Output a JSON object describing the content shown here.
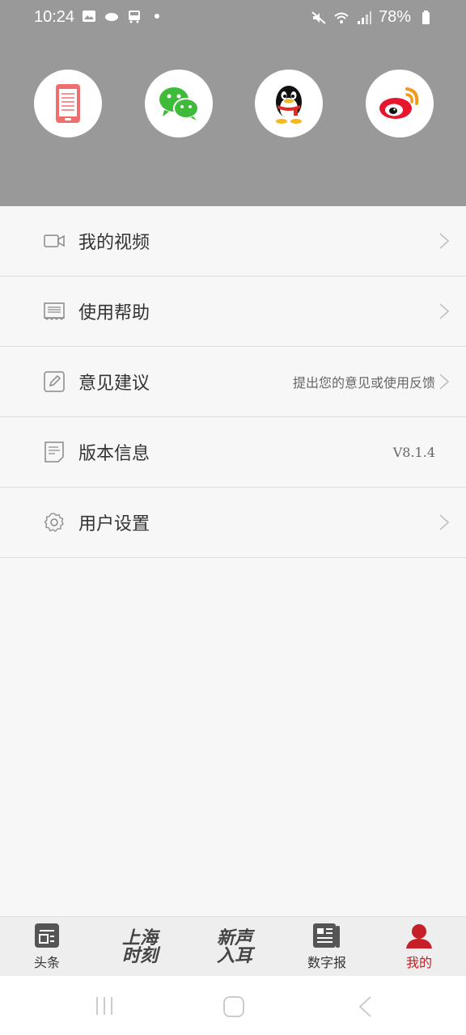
{
  "status_bar": {
    "time": "10:24",
    "battery": "78%"
  },
  "login": {
    "options": [
      "phone-icon",
      "wechat-icon",
      "qq-icon",
      "weibo-icon"
    ]
  },
  "menu": {
    "items": [
      {
        "label": "我的视频",
        "icon": "video-icon",
        "right": ""
      },
      {
        "label": "使用帮助",
        "icon": "help-doc-icon",
        "right": ""
      },
      {
        "label": "意见建议",
        "icon": "edit-icon",
        "right": "提出您的意见或使用反馈"
      },
      {
        "label": "版本信息",
        "icon": "info-doc-icon",
        "right": "V8.1.4"
      },
      {
        "label": "用户设置",
        "icon": "gear-icon",
        "right": ""
      }
    ]
  },
  "bottom_nav": {
    "headlines": "头条",
    "shanghai_line1": "上海",
    "shanghai_line2": "时刻",
    "voice_line1": "新声",
    "voice_line2": "入耳",
    "digital": "数字报",
    "mine": "我的"
  },
  "colors": {
    "header_bg": "#999999",
    "accent": "#c51f27"
  }
}
